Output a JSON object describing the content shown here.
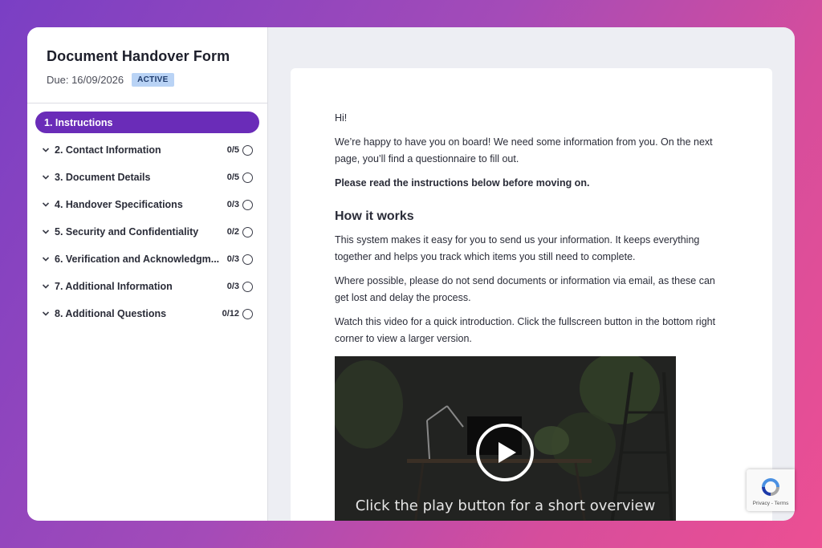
{
  "form": {
    "title": "Document Handover Form",
    "due": "Due: 16/09/2026",
    "status": "ACTIVE"
  },
  "nav": {
    "items": [
      {
        "label": "1. Instructions",
        "count": "",
        "active": true
      },
      {
        "label": "2. Contact Information",
        "count": "0/5"
      },
      {
        "label": "3. Document Details",
        "count": "0/5"
      },
      {
        "label": "4. Handover Specifications",
        "count": "0/3"
      },
      {
        "label": "5. Security and Confidentiality",
        "count": "0/2"
      },
      {
        "label": "6. Verification and Acknowledgm...",
        "count": "0/3"
      },
      {
        "label": "7. Additional Information",
        "count": "0/3"
      },
      {
        "label": "8. Additional Questions",
        "count": "0/12"
      }
    ]
  },
  "content": {
    "greeting": "Hi!",
    "intro": "We’re happy to have you on board! We need some information from you. On the next page, you’ll find a questionnaire to fill out.",
    "notice": "Please read the instructions below before moving on.",
    "heading": "How it works",
    "para1": "This system makes it easy for you to send us your information. It keeps everything together and helps you track which items you still need to complete.",
    "para2": "Where possible, please do not send documents or information via email, as these can get lost and delay the process.",
    "para3": "Watch this video for a quick introduction. Click the fullscreen button in the bottom right corner to view a larger version.",
    "video_caption": "Click the play button for a short overview"
  },
  "recaptcha": {
    "links": "Privacy - Terms"
  },
  "colors": {
    "accent": "#6a2cb8",
    "badge_bg": "#b9d3f5"
  }
}
